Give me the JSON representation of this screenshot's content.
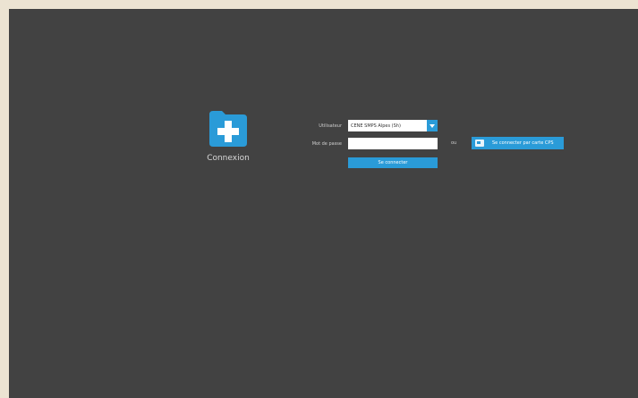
{
  "app": {
    "logo_label": "Connexion",
    "logo_icon": "folder-plus-icon"
  },
  "login": {
    "user_label": "Utilisateur",
    "user_value": "CENE SMPS Alpes (Sh)",
    "password_label": "Mot de passe",
    "password_value": "",
    "submit_label": "Se connecter",
    "or_label": "ou",
    "card_button_label": "Se connecter par carte CPS",
    "card_icon": "card-reader-icon"
  },
  "colors": {
    "accent": "#2a9bd8",
    "background": "#424242",
    "frame": "#ece3d2"
  }
}
